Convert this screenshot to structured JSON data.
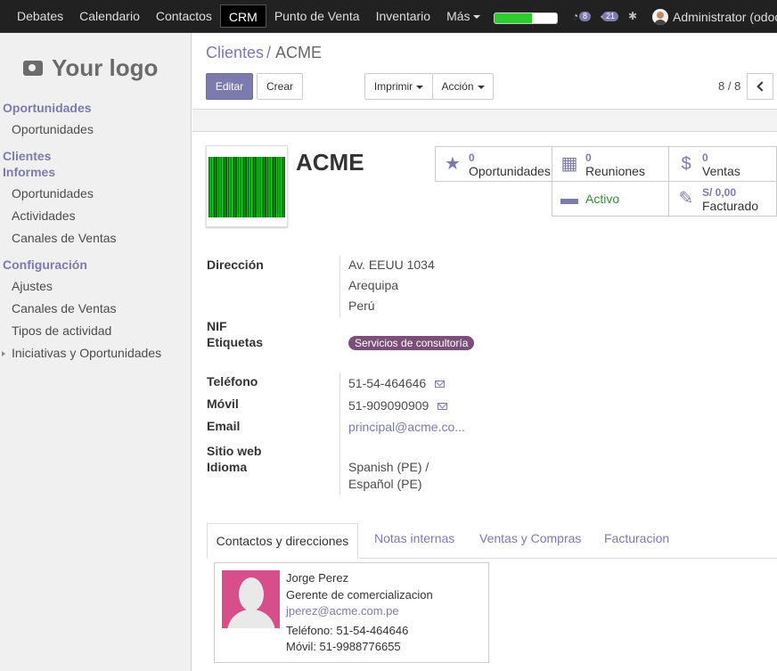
{
  "topbar": {
    "menu": [
      "Debates",
      "Calendario",
      "Contactos",
      "CRM",
      "Punto de Venta",
      "Inventario",
      "Más"
    ],
    "active_menu": "CRM",
    "progress": 0.6,
    "chat_count": "8",
    "message_count": "21",
    "user": "Administrator (odoo_"
  },
  "sidebar": {
    "logo_text": "Your logo",
    "items": [
      {
        "label": "Oportunidades",
        "type": "header"
      },
      {
        "label": "Oportunidades",
        "type": "item"
      },
      {
        "label": "Clientes",
        "type": "header"
      },
      {
        "label": "Informes",
        "type": "header"
      },
      {
        "label": "Oportunidades",
        "type": "item"
      },
      {
        "label": "Actividades",
        "type": "item"
      },
      {
        "label": "Canales de Ventas",
        "type": "item"
      },
      {
        "label": "Configuración",
        "type": "header"
      },
      {
        "label": "Ajustes",
        "type": "item"
      },
      {
        "label": "Canales de Ventas",
        "type": "item"
      },
      {
        "label": "Tipos de actividad",
        "type": "item"
      },
      {
        "label": "Iniciativas y Oportunidades",
        "type": "item"
      }
    ]
  },
  "breadcrumb": {
    "parent": "Clientes",
    "separator": "/",
    "current": "ACME"
  },
  "buttons": {
    "edit": "Editar",
    "create": "Crear",
    "print": "Imprimir",
    "action": "Acción"
  },
  "pager": "8 / 8",
  "record": {
    "name": "ACME",
    "smart_buttons": [
      {
        "icon": "star-icon",
        "value": "0",
        "label": "Oportunidades"
      },
      {
        "icon": "calendar-icon",
        "value": "0",
        "label": "Reuniones"
      },
      {
        "icon": "dollar-icon",
        "value": "0",
        "label": "Ventas"
      },
      {
        "icon": "archive-icon",
        "value": "",
        "label": "Activo"
      },
      {
        "icon": "edit-icon",
        "value": "S/ 0,00",
        "label": "Facturado"
      }
    ],
    "fields": {
      "address_label": "Dirección",
      "address": [
        "Av. EEUU 1034",
        "Arequipa",
        "Perú"
      ],
      "nif_label": "NIF",
      "tags_label": "Etiquetas",
      "tag": "Servicios de consultoría",
      "phone_label": "Teléfono",
      "phone": "51-54-464646",
      "mobile_label": "Móvil",
      "mobile": "51-909090909",
      "email_label": "Email",
      "email": "principal@acme.co...",
      "website_label": "Sitio web",
      "language_label": "Idioma",
      "language": [
        "Spanish (PE) /",
        "Español (PE)"
      ]
    }
  },
  "tabs": [
    "Contactos y direcciones",
    "Notas internas",
    "Ventas y Compras",
    "Facturacion"
  ],
  "contact": {
    "name": "Jorge Perez",
    "title": "Gerente de comercializacion",
    "email": "jperez@acme.com.pe",
    "phone": "Teléfono: 51-54-464646",
    "mobile": "Móvil: 51-9988776655"
  }
}
